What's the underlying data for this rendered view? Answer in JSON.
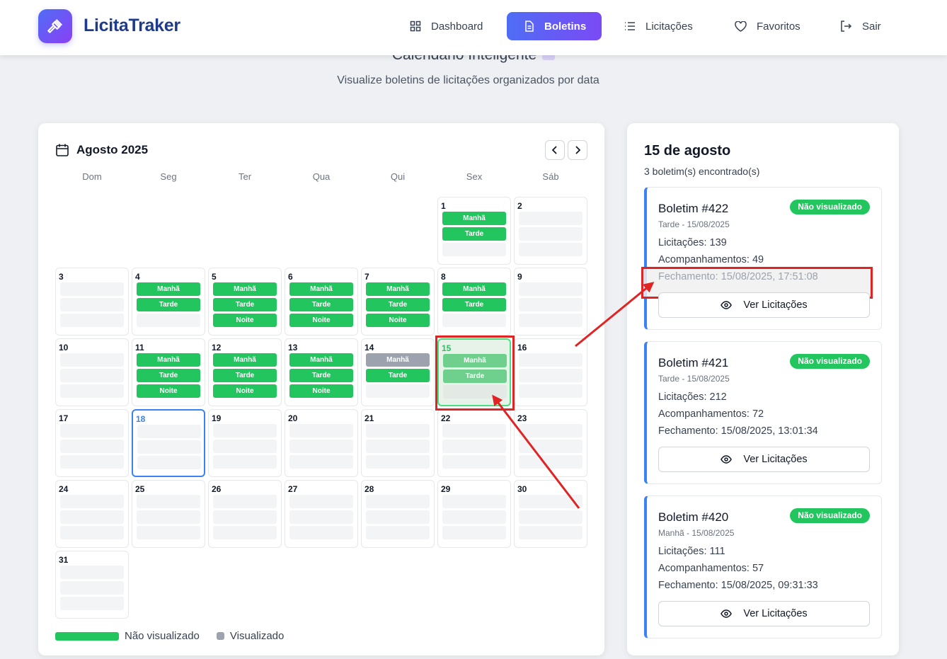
{
  "header": {
    "brand": "LicitaTraker",
    "nav": [
      {
        "label": "Dashboard",
        "icon": "dashboard-icon",
        "active": false
      },
      {
        "label": "Boletins",
        "icon": "document-icon",
        "active": true
      },
      {
        "label": "Licitações",
        "icon": "list-icon",
        "active": false
      },
      {
        "label": "Favoritos",
        "icon": "heart-icon",
        "active": false
      },
      {
        "label": "Sair",
        "icon": "logout-icon",
        "active": false
      }
    ]
  },
  "page": {
    "title": "Calendário Inteligente",
    "subtitle": "Visualize boletins de licitações organizados por data"
  },
  "calendar": {
    "month_label": "Agosto 2025",
    "weekdays": [
      "Dom",
      "Seg",
      "Ter",
      "Qua",
      "Qui",
      "Sex",
      "Sáb"
    ],
    "days": [
      {
        "n": "1",
        "slots": [
          [
            "Manhã",
            "green"
          ],
          [
            "Tarde",
            "green"
          ],
          [
            "",
            "empty"
          ]
        ]
      },
      {
        "n": "2",
        "slots": [
          [
            "",
            "empty"
          ],
          [
            "",
            "empty"
          ],
          [
            "",
            "empty"
          ]
        ]
      },
      {
        "n": "3",
        "slots": [
          [
            "",
            "empty"
          ],
          [
            "",
            "empty"
          ],
          [
            "",
            "empty"
          ]
        ]
      },
      {
        "n": "4",
        "slots": [
          [
            "Manhã",
            "green"
          ],
          [
            "Tarde",
            "green"
          ],
          [
            "",
            "empty"
          ]
        ]
      },
      {
        "n": "5",
        "slots": [
          [
            "Manhã",
            "green"
          ],
          [
            "Tarde",
            "green"
          ],
          [
            "Noite",
            "green"
          ]
        ]
      },
      {
        "n": "6",
        "slots": [
          [
            "Manhã",
            "green"
          ],
          [
            "Tarde",
            "green"
          ],
          [
            "Noite",
            "green"
          ]
        ]
      },
      {
        "n": "7",
        "slots": [
          [
            "Manhã",
            "green"
          ],
          [
            "Tarde",
            "green"
          ],
          [
            "Noite",
            "green"
          ]
        ]
      },
      {
        "n": "8",
        "slots": [
          [
            "Manhã",
            "green"
          ],
          [
            "Tarde",
            "green"
          ],
          [
            "",
            "empty"
          ]
        ]
      },
      {
        "n": "9",
        "slots": [
          [
            "",
            "empty"
          ],
          [
            "",
            "empty"
          ],
          [
            "",
            "empty"
          ]
        ]
      },
      {
        "n": "10",
        "slots": [
          [
            "",
            "empty"
          ],
          [
            "",
            "empty"
          ],
          [
            "",
            "empty"
          ]
        ]
      },
      {
        "n": "11",
        "slots": [
          [
            "Manhã",
            "green"
          ],
          [
            "Tarde",
            "green"
          ],
          [
            "Noite",
            "green"
          ]
        ]
      },
      {
        "n": "12",
        "slots": [
          [
            "Manhã",
            "green"
          ],
          [
            "Tarde",
            "green"
          ],
          [
            "Noite",
            "green"
          ]
        ]
      },
      {
        "n": "13",
        "slots": [
          [
            "Manhã",
            "green"
          ],
          [
            "Tarde",
            "green"
          ],
          [
            "Noite",
            "green"
          ]
        ]
      },
      {
        "n": "14",
        "slots": [
          [
            "Manhã",
            "gray"
          ],
          [
            "Tarde",
            "green"
          ],
          [
            "",
            "empty"
          ]
        ]
      },
      {
        "n": "15",
        "slots": [
          [
            "Manhã",
            "green"
          ],
          [
            "Tarde",
            "green"
          ],
          [
            "",
            "empty"
          ]
        ],
        "state": "selected"
      },
      {
        "n": "16",
        "slots": [
          [
            "",
            "empty"
          ],
          [
            "",
            "empty"
          ],
          [
            "",
            "empty"
          ]
        ]
      },
      {
        "n": "17",
        "slots": [
          [
            "",
            "empty"
          ],
          [
            "",
            "empty"
          ],
          [
            "",
            "empty"
          ]
        ]
      },
      {
        "n": "18",
        "slots": [
          [
            "",
            "empty"
          ],
          [
            "",
            "empty"
          ],
          [
            "",
            "empty"
          ]
        ],
        "state": "today"
      },
      {
        "n": "19",
        "slots": [
          [
            "",
            "empty"
          ],
          [
            "",
            "empty"
          ],
          [
            "",
            "empty"
          ]
        ]
      },
      {
        "n": "20",
        "slots": [
          [
            "",
            "empty"
          ],
          [
            "",
            "empty"
          ],
          [
            "",
            "empty"
          ]
        ]
      },
      {
        "n": "21",
        "slots": [
          [
            "",
            "empty"
          ],
          [
            "",
            "empty"
          ],
          [
            "",
            "empty"
          ]
        ]
      },
      {
        "n": "22",
        "slots": [
          [
            "",
            "empty"
          ],
          [
            "",
            "empty"
          ],
          [
            "",
            "empty"
          ]
        ]
      },
      {
        "n": "23",
        "slots": [
          [
            "",
            "empty"
          ],
          [
            "",
            "empty"
          ],
          [
            "",
            "empty"
          ]
        ]
      },
      {
        "n": "24",
        "slots": [
          [
            "",
            "empty"
          ],
          [
            "",
            "empty"
          ],
          [
            "",
            "empty"
          ]
        ]
      },
      {
        "n": "25",
        "slots": [
          [
            "",
            "empty"
          ],
          [
            "",
            "empty"
          ],
          [
            "",
            "empty"
          ]
        ]
      },
      {
        "n": "26",
        "slots": [
          [
            "",
            "empty"
          ],
          [
            "",
            "empty"
          ],
          [
            "",
            "empty"
          ]
        ]
      },
      {
        "n": "27",
        "slots": [
          [
            "",
            "empty"
          ],
          [
            "",
            "empty"
          ],
          [
            "",
            "empty"
          ]
        ]
      },
      {
        "n": "28",
        "slots": [
          [
            "",
            "empty"
          ],
          [
            "",
            "empty"
          ],
          [
            "",
            "empty"
          ]
        ]
      },
      {
        "n": "29",
        "slots": [
          [
            "",
            "empty"
          ],
          [
            "",
            "empty"
          ],
          [
            "",
            "empty"
          ]
        ]
      },
      {
        "n": "30",
        "slots": [
          [
            "",
            "empty"
          ],
          [
            "",
            "empty"
          ],
          [
            "",
            "empty"
          ]
        ]
      },
      {
        "n": "31",
        "slots": [
          [
            "",
            "empty"
          ],
          [
            "",
            "empty"
          ],
          [
            "",
            "empty"
          ]
        ]
      }
    ],
    "legend": {
      "unseen": "Não visualizado",
      "seen": "Visualizado"
    }
  },
  "side": {
    "title": "15 de agosto",
    "count": "3 boletim(s) encontrado(s)",
    "boletins": [
      {
        "title": "Boletim #422",
        "badge": "Não visualizado",
        "meta": "Tarde - 15/08/2025",
        "licitacoes": "Licitações: 139",
        "acompanhamentos": "Acompanhamentos: 49",
        "fechamento": "Fechamento: 15/08/2025, 17:51:08",
        "button": "Ver Licitações"
      },
      {
        "title": "Boletim #421",
        "badge": "Não visualizado",
        "meta": "Tarde - 15/08/2025",
        "licitacoes": "Licitações: 212",
        "acompanhamentos": "Acompanhamentos: 72",
        "fechamento": "Fechamento: 15/08/2025, 13:01:34",
        "button": "Ver Licitações"
      },
      {
        "title": "Boletim #420",
        "badge": "Não visualizado",
        "meta": "Manhã - 15/08/2025",
        "licitacoes": "Licitações: 111",
        "acompanhamentos": "Acompanhamentos: 57",
        "fechamento": "Fechamento: 15/08/2025, 09:31:33",
        "button": "Ver Licitações"
      }
    ]
  },
  "colors": {
    "accent": "#4f6df5",
    "unseen": "#22c55e",
    "seen": "#9ca3af",
    "annotation": "#e02424"
  }
}
